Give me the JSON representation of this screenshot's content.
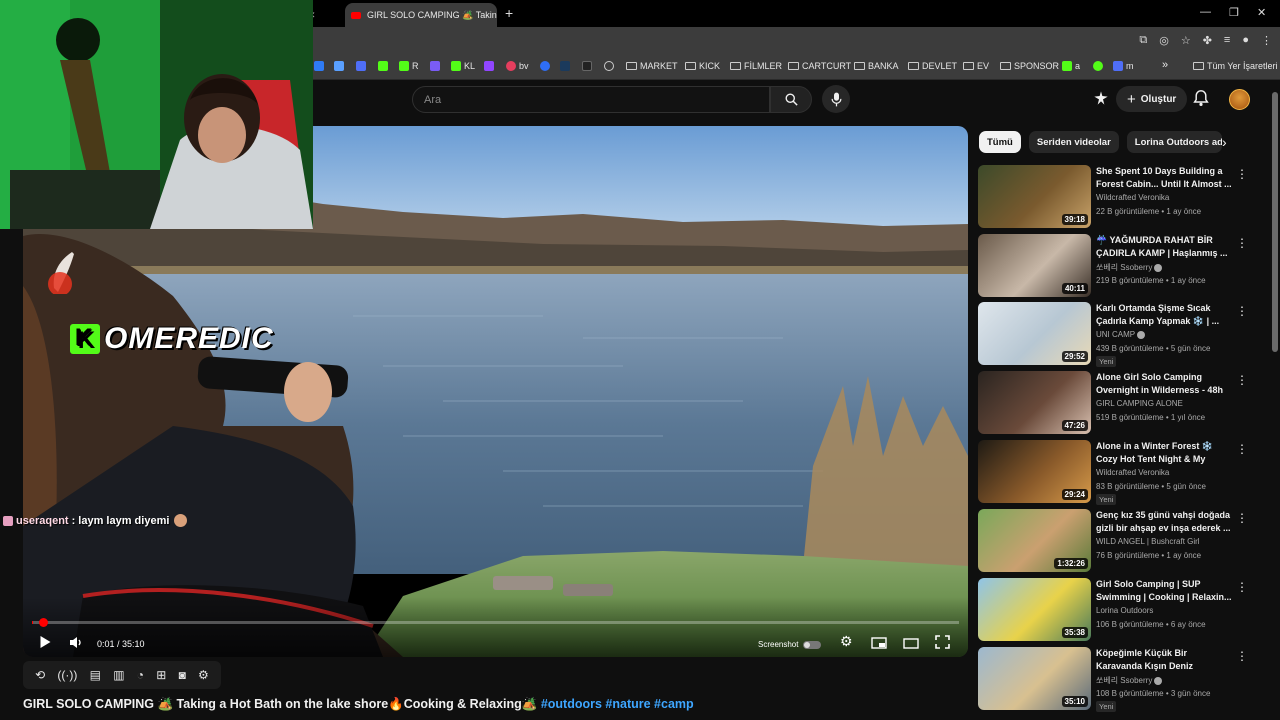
{
  "browser": {
    "tab_title": "GIRL SOLO CAMPING 🏕️ Takin",
    "new_tab": "+",
    "bookmarks": [
      {
        "label": "R",
        "color": "#53fc18"
      },
      {
        "label": "KL",
        "color": "#53fc18"
      },
      {
        "label": "bv",
        "color": "#e53e5e"
      },
      {
        "label": "MARKET",
        "folder": true
      },
      {
        "label": "KICK",
        "folder": true
      },
      {
        "label": "FİLMLER",
        "folder": true
      },
      {
        "label": "CARTCURT",
        "folder": true
      },
      {
        "label": "BANKA",
        "folder": true
      },
      {
        "label": "DEVLET",
        "folder": true
      },
      {
        "label": "EV",
        "folder": true
      },
      {
        "label": "SPONSOR",
        "folder": true
      },
      {
        "label": "a",
        "color": "#53fc18"
      },
      {
        "label": "m",
        "color": "#4f6ef7"
      }
    ],
    "all_bookmarks": "Tüm Yer İşaretleri",
    "more": "»"
  },
  "youtube": {
    "search_placeholder": "Ara",
    "create_label": "Oluştur"
  },
  "player": {
    "time": "0:01 / 35:10",
    "progress": 0.0005,
    "screenshot_label": "Screenshot"
  },
  "overlay": {
    "watermark": "OMEREDIC",
    "chat_user": "useraqent",
    "chat_message": ": laym laym diyemi"
  },
  "video": {
    "title": "GIRL SOLO CAMPING 🏕️ Taking a Hot Bath on the lake shore🔥Cooking & Relaxing🏕️",
    "hashtags": "#outdoors #nature #camp"
  },
  "chips": [
    "Tümü",
    "Seriden videolar",
    "Lorina Outdoors adlı y"
  ],
  "recommendations": [
    {
      "title": "She Spent 10 Days Building a Forest Cabin... Until It Almost ...",
      "channel": "Wildcrafted Veronika",
      "verified": false,
      "meta": "22 B görüntüleme • 1 ay önce",
      "duration": "39:18",
      "new": "",
      "colors": [
        "#3c4a2a",
        "#7a5a2e",
        "#c9a36a"
      ]
    },
    {
      "title": "☔ YAĞMURDA RAHAT BİR ÇADIRLA KAMP | Haşlanmış ...",
      "channel": "쏘베리 Ssoberry",
      "verified": true,
      "meta": "219 B görüntüleme • 1 ay önce",
      "duration": "40:11",
      "new": "",
      "colors": [
        "#6a5a4a",
        "#c8b8a8",
        "#3a3028"
      ]
    },
    {
      "title": "Karlı Ortamda Şişme Sıcak Çadırla Kamp Yapmak ❄️ | ...",
      "channel": "UNI CAMP",
      "verified": true,
      "meta": "439 B görüntüleme • 5 gün önce",
      "duration": "29:52",
      "new": "Yeni",
      "colors": [
        "#dfe6ec",
        "#b7c7d3",
        "#e8d9b6"
      ]
    },
    {
      "title": "Alone Girl Solo Camping Overnight in Wilderness - 48h ...",
      "channel": "GIRL CAMPING ALONE",
      "verified": false,
      "meta": "519 B görüntüleme • 1 yıl önce",
      "duration": "47:26",
      "new": "",
      "colors": [
        "#2a2420",
        "#6a4a3a",
        "#d8c0b0"
      ]
    },
    {
      "title": "Alone in a Winter Forest ❄️ Cozy Hot Tent Night & My Dog...",
      "channel": "Wildcrafted Veronika",
      "verified": false,
      "meta": "83 B görüntüleme • 5 gün önce",
      "duration": "29:24",
      "new": "Yeni",
      "colors": [
        "#1e1a14",
        "#8a5a2a",
        "#d69a4a"
      ]
    },
    {
      "title": "Genç kız 35 günü vahşi doğada gizli bir ahşap ev inşa ederek ...",
      "channel": "WILD ANGEL | Bushcraft Girl",
      "verified": false,
      "meta": "76 B görüntüleme • 1 ay önce",
      "duration": "1:32:26",
      "new": "",
      "colors": [
        "#7aa85a",
        "#caa070",
        "#5a7a3a"
      ]
    },
    {
      "title": "Girl Solo Camping | SUP Swimming | Cooking | Relaxin...",
      "channel": "Lorina Outdoors",
      "verified": false,
      "meta": "106 B görüntüleme • 6 ay önce",
      "duration": "35:38",
      "new": "",
      "colors": [
        "#8fc4e8",
        "#e8d24a",
        "#4a7a5a"
      ]
    },
    {
      "title": "Köpeğimle Küçük Bir Karavanda Kışın Deniz Kenarında Piknik ...",
      "channel": "쏘베리 Ssoberry",
      "verified": true,
      "meta": "108 B görüntüleme • 3 gün önce",
      "duration": "35:10",
      "new": "Yeni",
      "colors": [
        "#9cb8cf",
        "#d8c090",
        "#5a6a7a"
      ]
    }
  ]
}
